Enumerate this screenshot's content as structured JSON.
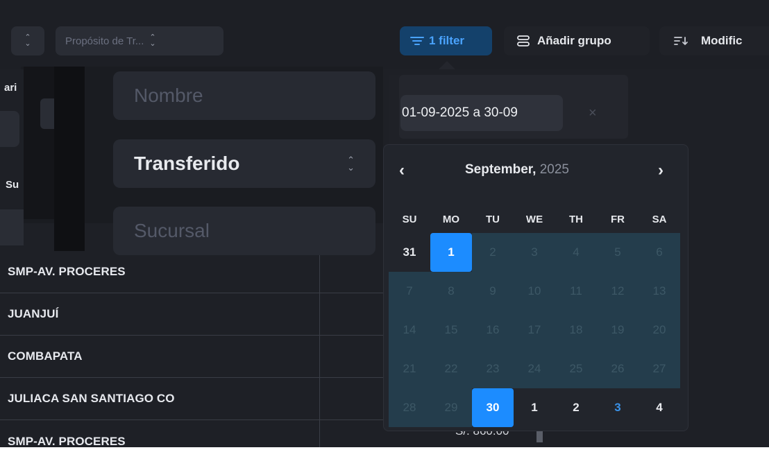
{
  "toolbar": {
    "left_chip_arrows": "⌃⌄",
    "purpose_chip": "Propósito de Tr...",
    "filter_button": "1 filter",
    "group_button": "Añadir grupo",
    "modify_button": "Modific"
  },
  "filters": {
    "name_placeholder": "Nombre",
    "status_value": "Transferido",
    "branch_placeholder": "Sucursal",
    "partial_label_1": "ari",
    "partial_label_2": "Su"
  },
  "date_range": {
    "value": "01-09-2025 a 30-09",
    "clear_icon": "×"
  },
  "calendar": {
    "month": "September,",
    "year": "2025",
    "prev_icon": "‹",
    "next_icon": "›",
    "weekdays": [
      "SU",
      "MO",
      "TU",
      "WE",
      "TH",
      "FR",
      "SA"
    ],
    "weeks": [
      [
        "31",
        "1",
        "2",
        "3",
        "4",
        "5",
        "6"
      ],
      [
        "7",
        "8",
        "9",
        "10",
        "11",
        "12",
        "13"
      ],
      [
        "14",
        "15",
        "16",
        "17",
        "18",
        "19",
        "20"
      ],
      [
        "21",
        "22",
        "23",
        "24",
        "25",
        "26",
        "27"
      ],
      [
        "28",
        "29",
        "30",
        "1",
        "2",
        "3",
        "4"
      ]
    ],
    "range_start": "1",
    "range_end": "30",
    "accent_color": "#1c8cff",
    "range_color": "#243d4c"
  },
  "table": {
    "rows": [
      "SMP-AV. PROCERES",
      "JUANJUÍ",
      "COMBAPATA",
      "JULIACA SAN SANTIAGO CO",
      "SMP-AV. PROCERES"
    ],
    "last_row_amount": "S/. 860.00"
  }
}
